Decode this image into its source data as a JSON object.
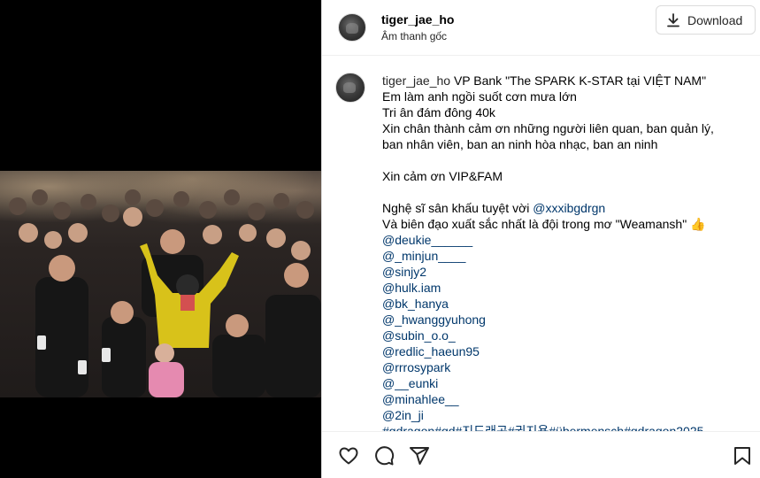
{
  "header": {
    "username": "tiger_jae_ho",
    "subtitle": "Âm thanh gốc",
    "download_label": "Download"
  },
  "caption": {
    "username": "tiger_jae_ho",
    "first_line": "VP Bank \"The SPARK K-STAR tại VIỆT NAM\"",
    "lines": [
      "Em làm anh ngồi suốt cơn mưa lớn",
      "Tri ân đám đông 40k",
      "Xin chân thành cảm ơn những người liên quan, ban quản lý,",
      "ban nhân viên, ban an ninh hòa nhạc, ban an ninh"
    ],
    "thanks_line": "Xin cảm ơn VIP&FAM",
    "artist_prefix": "Nghệ sĩ sân khấu tuyệt vời ",
    "artist_mention": "@xxxibgdrgn",
    "director_line": "Và biên đạo xuất sắc nhất là đội trong mơ \"Weamansh\" 👍",
    "mentions": [
      "@deukie______",
      "@_minjun____",
      "@sinjy2",
      "@hulk.iam",
      "@bk_hanya",
      "@_hwanggyuhong",
      "@subin_o.o_",
      "@redlic_haeun95",
      "@rrrosypark",
      "@__eunki",
      "@minahlee__",
      "@2in_ji"
    ],
    "hashtags": "#gdragon#gd#지드래곤#권지용#übermensch#gdragon2025"
  },
  "actions": {
    "like_icon": "heart-icon",
    "comment_icon": "comment-icon",
    "share_icon": "share-icon",
    "save_icon": "bookmark-icon"
  }
}
